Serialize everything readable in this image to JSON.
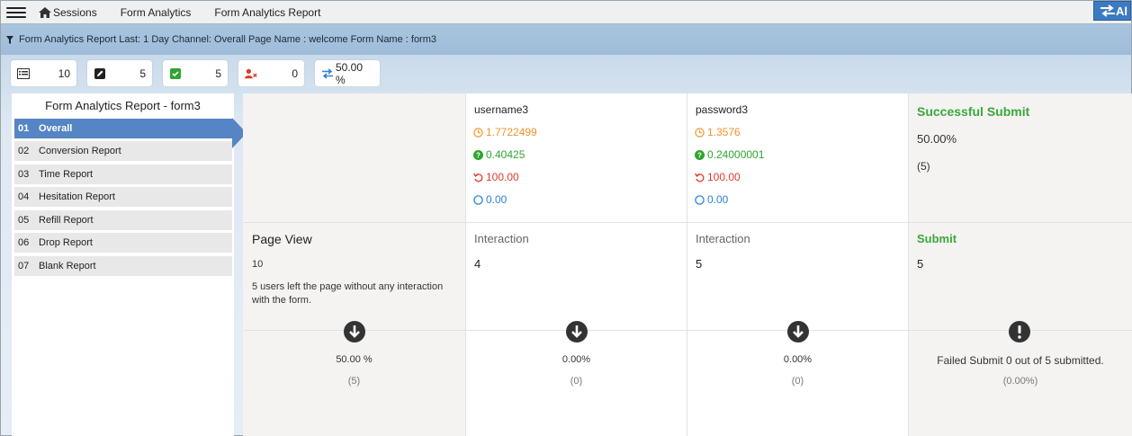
{
  "nav": {
    "items": [
      "Sessions",
      "Form Analytics",
      "Form Analytics Report"
    ],
    "right_button": "Al"
  },
  "filter": {
    "text": "Form Analytics Report Last: 1 Day Channel: Overall Page Name : welcome Form Name : form3"
  },
  "stats": [
    {
      "icon": "list-icon",
      "value": "10"
    },
    {
      "icon": "edit-icon",
      "value": "5"
    },
    {
      "icon": "checkbox-icon",
      "value": "5"
    },
    {
      "icon": "user-remove-icon",
      "value": "0"
    },
    {
      "icon": "swap-icon",
      "value": "50.00 %"
    }
  ],
  "sidebar": {
    "title": "Form Analytics Report - form3",
    "items": [
      {
        "num": "01",
        "label": "Overall",
        "active": true
      },
      {
        "num": "02",
        "label": "Conversion Report"
      },
      {
        "num": "03",
        "label": "Time Report"
      },
      {
        "num": "04",
        "label": "Hesitation Report"
      },
      {
        "num": "05",
        "label": "Refill Report"
      },
      {
        "num": "06",
        "label": "Drop Report"
      },
      {
        "num": "07",
        "label": "Blank Report"
      }
    ]
  },
  "fields": [
    {
      "name": "username3",
      "time": "1.7722499",
      "hesitation": "0.40425",
      "refill": "100.00",
      "blank": "0.00",
      "interaction_label": "Interaction",
      "interaction_value": "4",
      "drop_percent": "0.00%",
      "drop_count": "(0)"
    },
    {
      "name": "password3",
      "time": "1.3576",
      "hesitation": "0.24000001",
      "refill": "100.00",
      "blank": "0.00",
      "interaction_label": "Interaction",
      "interaction_value": "5",
      "drop_percent": "0.00%",
      "drop_count": "(0)"
    }
  ],
  "page_view": {
    "title": "Page View",
    "value": "10",
    "note": "5 users left the page without any interaction with the form.",
    "drop_percent": "50.00 %",
    "drop_count": "(5)"
  },
  "success": {
    "title": "Successful Submit",
    "percent": "50.00%",
    "count": "(5)",
    "submit_label": "Submit",
    "submit_value": "5",
    "failed_text": "Failed Submit 0 out of 5 submitted.",
    "failed_percent": "(0.00%)"
  },
  "colors": {
    "accent": "#5585c4",
    "success": "#3aa83a",
    "time": "#f0932b",
    "hesitation": "#2ea52e",
    "refill": "#e03b2a",
    "blank": "#2f80d8"
  }
}
